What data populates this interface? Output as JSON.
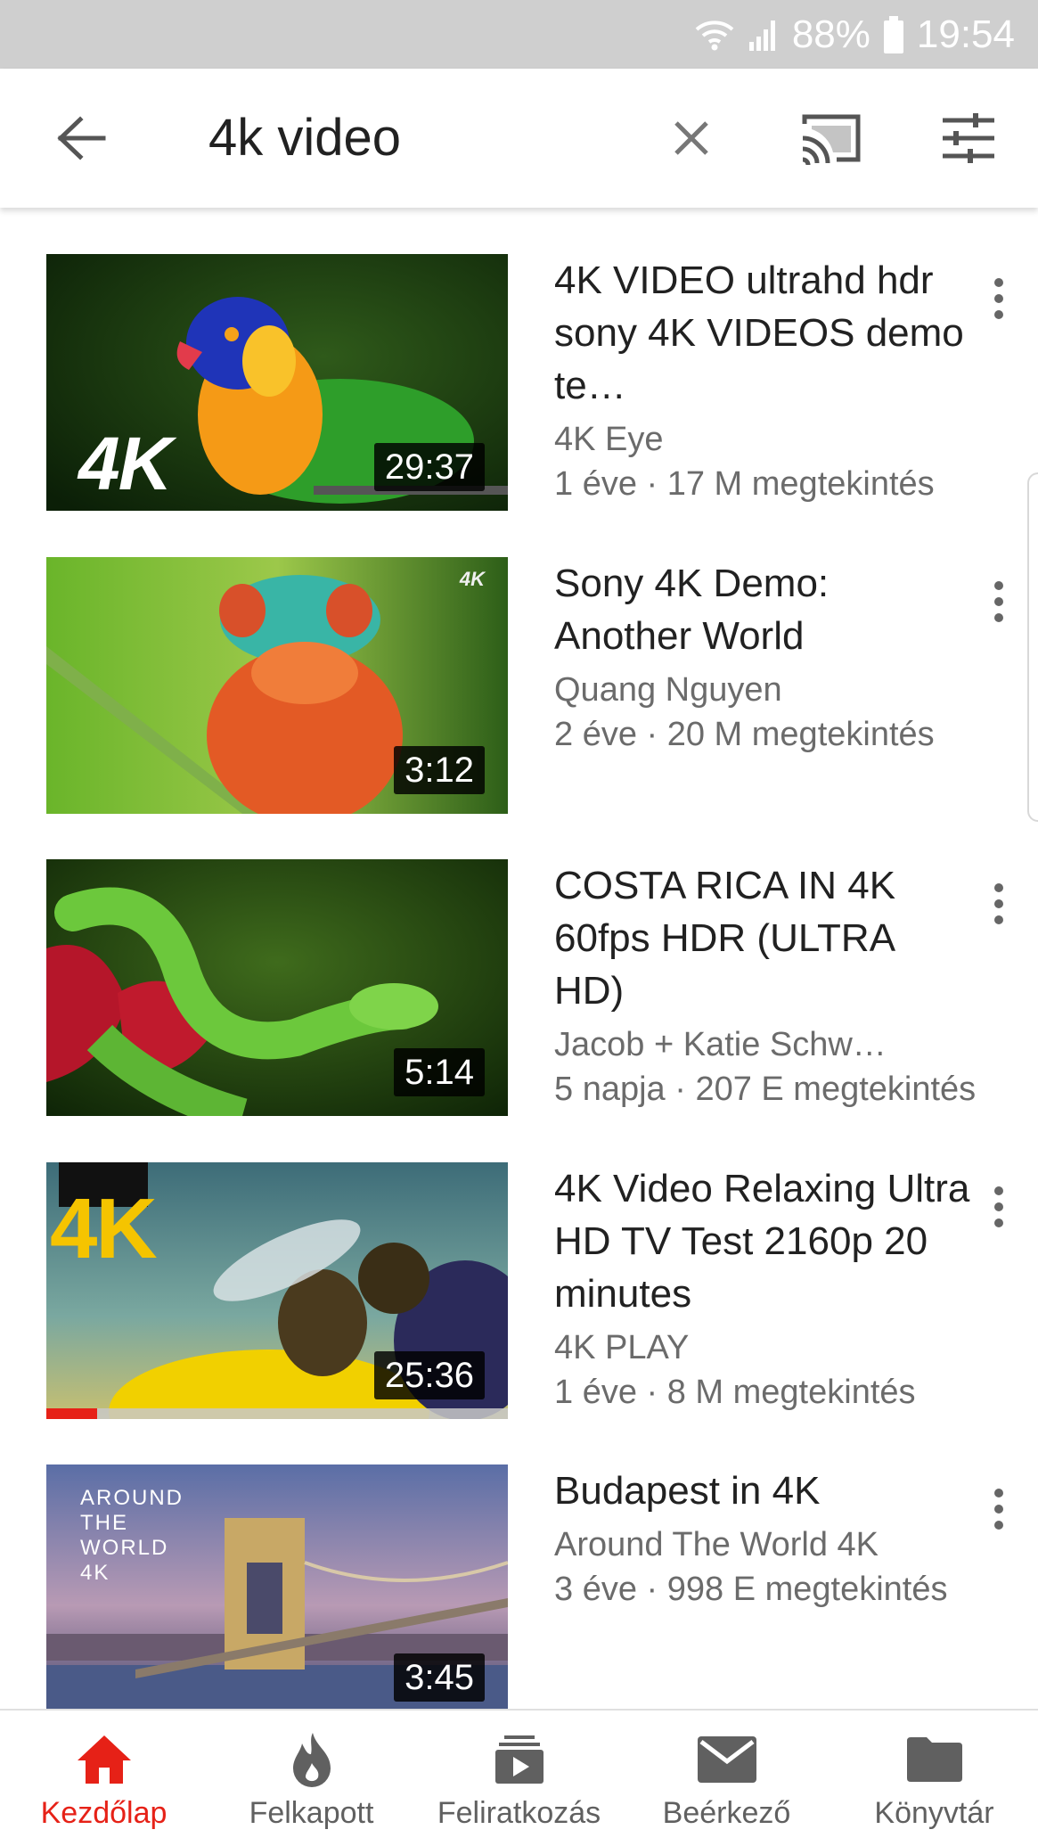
{
  "status_bar": {
    "battery": "88%",
    "time": "19:54"
  },
  "search": {
    "query": "4k video"
  },
  "videos": [
    {
      "title": "4K VIDEO ultrahd hdr sony 4K VIDEOS demo te…",
      "channel": "4K Eye",
      "stats": "1 éve · 17 M megtekintés",
      "duration": "29:37",
      "thumb_text": "4K",
      "watched_fraction": 0
    },
    {
      "title": "Sony 4K Demo: Another World",
      "channel": "Quang Nguyen",
      "stats": "2 éve · 20 M megtekintés",
      "duration": "3:12",
      "thumb_text": "4K",
      "watched_fraction": 0
    },
    {
      "title": "COSTA RICA IN 4K 60fps HDR (ULTRA HD)",
      "channel": "Jacob + Katie Schw…",
      "stats": "5 napja · 207 E megtekintés",
      "duration": "5:14",
      "thumb_text": "",
      "watched_fraction": 0
    },
    {
      "title": "4K Video Relaxing Ultra HD TV Test 2160p 20 minutes",
      "channel": "4K PLAY",
      "stats": "1 éve · 8 M megtekintés",
      "duration": "25:36",
      "thumb_text": "4K",
      "watched_fraction": 0.11
    },
    {
      "title": "Budapest in 4K",
      "channel": "Around The World 4K",
      "stats": "3 éve · 998 E megtekintés",
      "duration": "3:45",
      "thumb_text": "AROUND THE WORLD 4K",
      "watched_fraction": 0
    }
  ],
  "bottom_nav": [
    {
      "label": "Kezdőlap",
      "icon": "home-icon",
      "active": true
    },
    {
      "label": "Felkapott",
      "icon": "trending-flame-icon",
      "active": false
    },
    {
      "label": "Feliratkozás",
      "icon": "subscriptions-icon",
      "active": false
    },
    {
      "label": "Beérkező",
      "icon": "inbox-mail-icon",
      "active": false
    },
    {
      "label": "Könyvtár",
      "icon": "library-folder-icon",
      "active": false
    }
  ],
  "colors": {
    "accent": "#e62117",
    "status_bar": "#cfcfcf",
    "secondary_text": "#6b6b6b"
  }
}
